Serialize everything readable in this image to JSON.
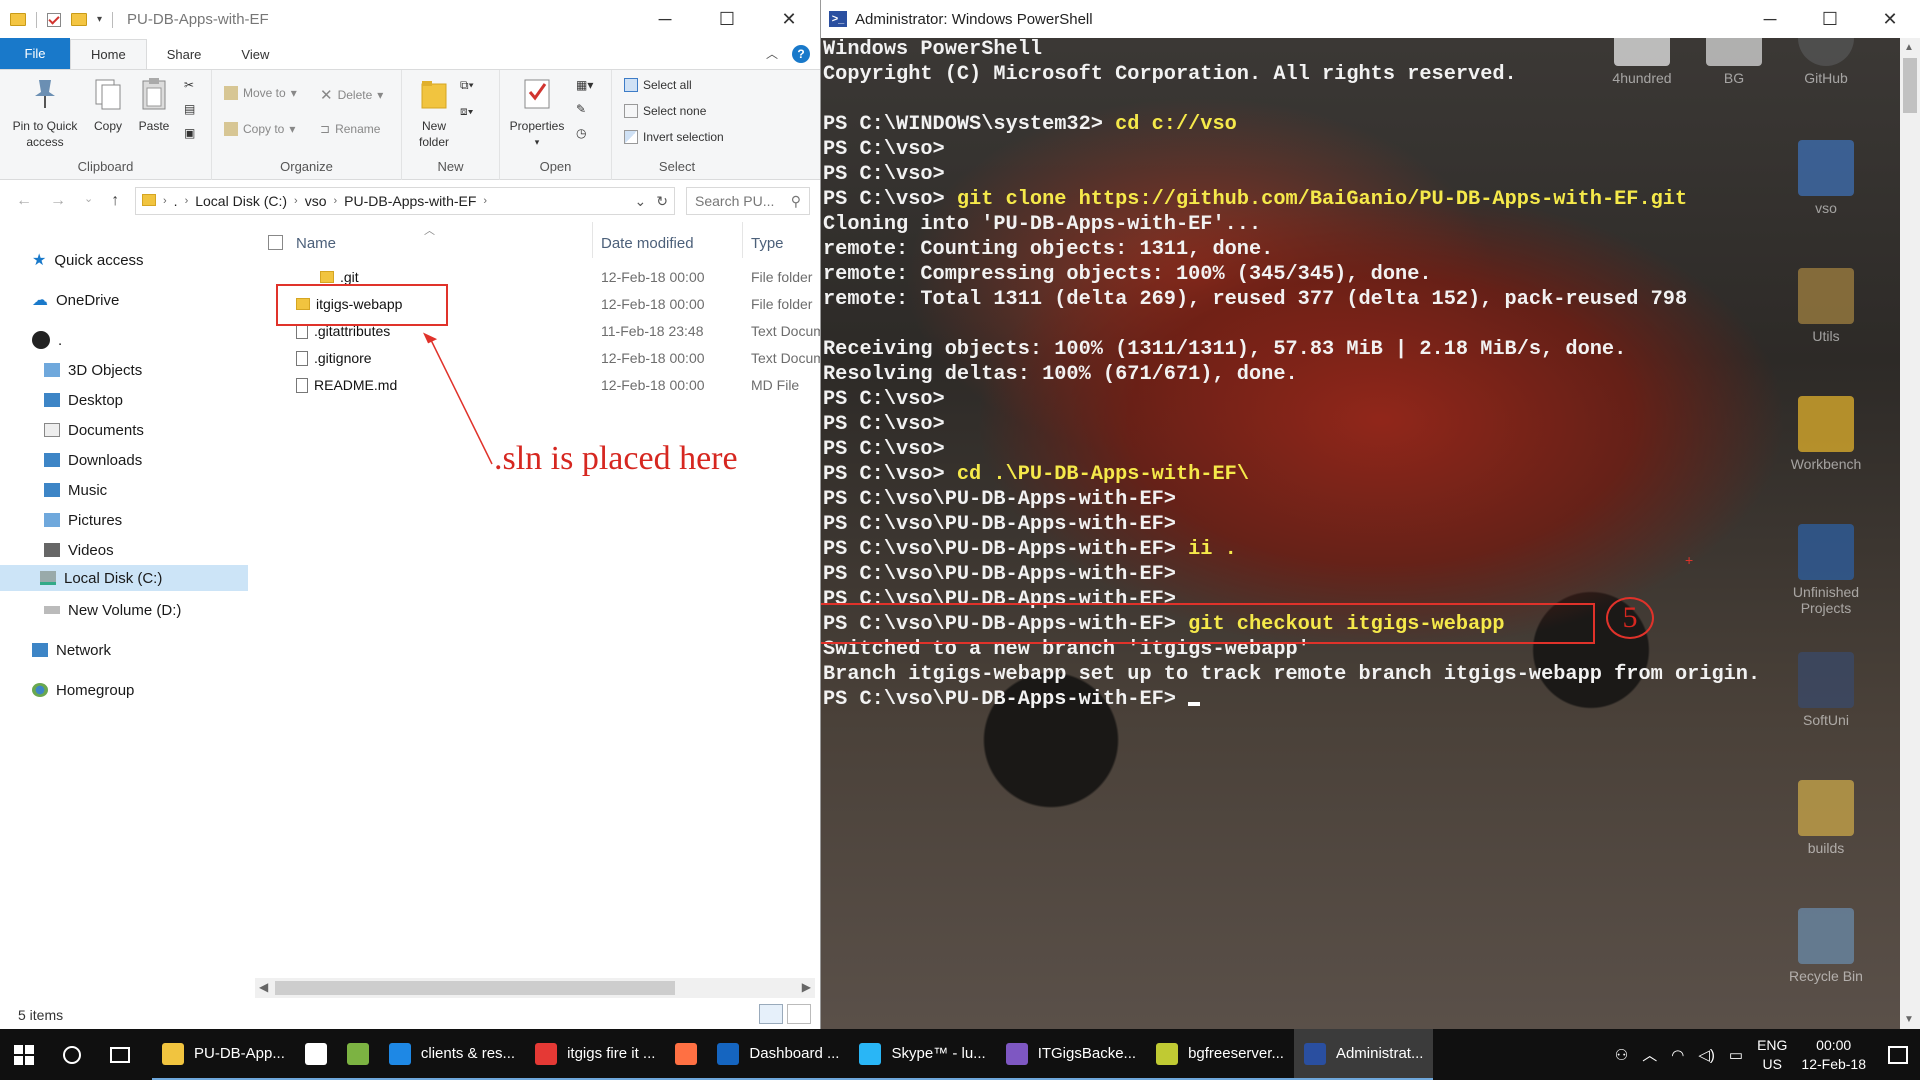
{
  "explorer": {
    "title": "PU-DB-Apps-with-EF",
    "ribbon_tabs": [
      "File",
      "Home",
      "Share",
      "View"
    ],
    "ribbon": {
      "clipboard": {
        "label": "Clipboard",
        "pin": "Pin to Quick access",
        "copy": "Copy",
        "paste": "Paste"
      },
      "organize": {
        "label": "Organize",
        "move_to": "Move to",
        "copy_to": "Copy to",
        "delete": "Delete",
        "rename": "Rename"
      },
      "new": {
        "label": "New",
        "new_folder": "New folder"
      },
      "open": {
        "label": "Open",
        "properties": "Properties"
      },
      "select": {
        "label": "Select",
        "select_all": "Select all",
        "select_none": "Select none",
        "invert": "Invert selection"
      }
    },
    "breadcrumb": [
      "Local Disk (C:)",
      "vso",
      "PU-DB-Apps-with-EF"
    ],
    "search_placeholder": "Search PU...",
    "nav": {
      "quick_access": "Quick access",
      "onedrive": "OneDrive",
      "user": ".",
      "items": [
        "3D Objects",
        "Desktop",
        "Documents",
        "Downloads",
        "Music",
        "Pictures",
        "Videos",
        "Local Disk (C:)",
        "New Volume (D:)"
      ],
      "network": "Network",
      "homegroup": "Homegroup"
    },
    "columns": {
      "name": "Name",
      "date": "Date modified",
      "type": "Type"
    },
    "files": [
      {
        "name": ".git",
        "date": "12-Feb-18 00:00",
        "type": "File folder",
        "kind": "folder"
      },
      {
        "name": "itgigs-webapp",
        "date": "12-Feb-18 00:00",
        "type": "File folder",
        "kind": "folder"
      },
      {
        "name": ".gitattributes",
        "date": "11-Feb-18 23:48",
        "type": "Text Docum",
        "kind": "file"
      },
      {
        "name": ".gitignore",
        "date": "12-Feb-18 00:00",
        "type": "Text Docum",
        "kind": "file"
      },
      {
        "name": "README.md",
        "date": "12-Feb-18 00:00",
        "type": "MD File",
        "kind": "file"
      }
    ],
    "annotation": ".sln is placed here",
    "status": "5 items"
  },
  "powershell": {
    "title": "Administrator: Windows PowerShell",
    "lines": [
      {
        "text": "Windows PowerShell",
        "cmd": ""
      },
      {
        "text": "Copyright (C) Microsoft Corporation. All rights reserved.",
        "cmd": ""
      },
      {
        "text": "",
        "cmd": ""
      },
      {
        "text": "PS C:\\WINDOWS\\system32> ",
        "cmd": "cd c://vso"
      },
      {
        "text": "PS C:\\vso>",
        "cmd": ""
      },
      {
        "text": "PS C:\\vso>",
        "cmd": ""
      },
      {
        "text": "PS C:\\vso> ",
        "cmd": "git clone https://github.com/BaiGanio/PU-DB-Apps-with-EF.git"
      },
      {
        "text": "Cloning into 'PU-DB-Apps-with-EF'...",
        "cmd": ""
      },
      {
        "text": "remote: Counting objects: 1311, done.",
        "cmd": ""
      },
      {
        "text": "remote: Compressing objects: 100% (345/345), done.",
        "cmd": ""
      },
      {
        "text": "remote: Total 1311 (delta 269), reused 377 (delta 152), pack-reused 798",
        "cmd": ""
      },
      {
        "text": "",
        "cmd": ""
      },
      {
        "text": "Receiving objects: 100% (1311/1311), 57.83 MiB | 2.18 MiB/s, done.",
        "cmd": ""
      },
      {
        "text": "Resolving deltas: 100% (671/671), done.",
        "cmd": ""
      },
      {
        "text": "PS C:\\vso>",
        "cmd": ""
      },
      {
        "text": "PS C:\\vso>",
        "cmd": ""
      },
      {
        "text": "PS C:\\vso>",
        "cmd": ""
      },
      {
        "text": "PS C:\\vso> ",
        "cmd": "cd .\\PU-DB-Apps-with-EF\\"
      },
      {
        "text": "PS C:\\vso\\PU-DB-Apps-with-EF>",
        "cmd": ""
      },
      {
        "text": "PS C:\\vso\\PU-DB-Apps-with-EF>",
        "cmd": ""
      },
      {
        "text": "PS C:\\vso\\PU-DB-Apps-with-EF> ",
        "cmd": "ii ."
      },
      {
        "text": "PS C:\\vso\\PU-DB-Apps-with-EF>",
        "cmd": ""
      },
      {
        "text": "PS C:\\vso\\PU-DB-Apps-with-EF>",
        "cmd": ""
      },
      {
        "text": "PS C:\\vso\\PU-DB-Apps-with-EF> ",
        "cmd": "git checkout itgigs-webapp"
      },
      {
        "text": "Switched to a new branch 'itgigs-webapp'",
        "cmd": ""
      },
      {
        "text": "Branch itgigs-webapp set up to track remote branch itgigs-webapp from origin.",
        "cmd": ""
      },
      {
        "text": "PS C:\\vso\\PU-DB-Apps-with-EF> ",
        "cmd": ""
      }
    ],
    "step_badge": "5"
  },
  "desktop_icons": [
    "4hundred",
    "BG",
    "GitHub",
    "vso",
    "Utils",
    "Workbench",
    "Unfinished Projects",
    "SoftUni",
    "builds",
    "Recycle Bin"
  ],
  "taskbar": {
    "apps": [
      {
        "label": "PU-DB-App...",
        "icon": "folder-icon",
        "color": "#f1c43f"
      },
      {
        "label": "",
        "icon": "mail-icon",
        "color": "#ffffff"
      },
      {
        "label": "",
        "icon": "notepad-icon",
        "color": "#7cb342"
      },
      {
        "label": "clients & res...",
        "icon": "edge-icon",
        "color": "#1e88e5"
      },
      {
        "label": "itgigs fire it ...",
        "icon": "chrome-icon",
        "color": "#e53935"
      },
      {
        "label": "",
        "icon": "firefox-icon",
        "color": "#ff7043"
      },
      {
        "label": "Dashboard ...",
        "icon": "browser-icon",
        "color": "#1565c0"
      },
      {
        "label": "Skype™ - lu...",
        "icon": "skype-icon",
        "color": "#29b6f6"
      },
      {
        "label": "ITGigsBacke...",
        "icon": "visual-studio-icon",
        "color": "#7e57c2"
      },
      {
        "label": "bgfreeserver...",
        "icon": "filezilla-icon",
        "color": "#c0ca33"
      },
      {
        "label": "Administrat...",
        "icon": "powershell-icon",
        "color": "#2a4fa0"
      }
    ],
    "lang_top": "ENG",
    "lang_bottom": "US",
    "time": "00:00",
    "date": "12-Feb-18"
  }
}
